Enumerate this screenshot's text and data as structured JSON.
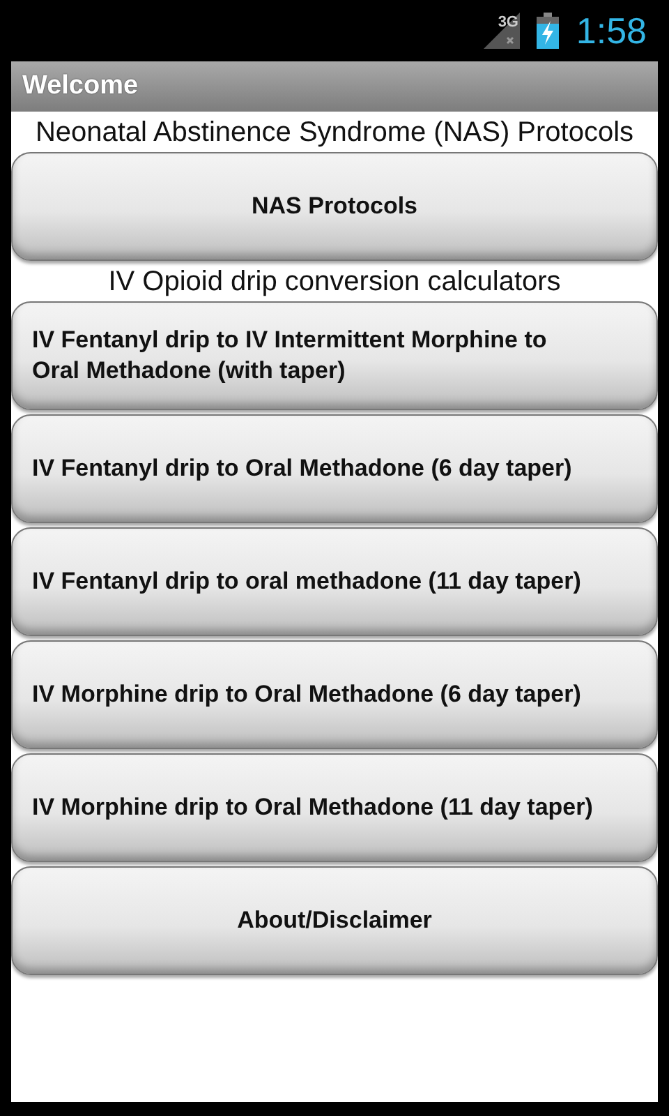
{
  "status_bar": {
    "network": "3G",
    "time": "1:58"
  },
  "title_bar": {
    "title": "Welcome"
  },
  "items": [
    {
      "kind": "heading",
      "text": "Neonatal Abstinence Syndrome (NAS) Protocols"
    },
    {
      "kind": "button",
      "text": "NAS Protocols",
      "centered": true
    },
    {
      "kind": "heading",
      "text": "IV Opioid drip conversion calculators"
    },
    {
      "kind": "button",
      "text": "IV Fentanyl drip to IV Intermittent Morphine to Oral Methadone (with taper)",
      "centered": false
    },
    {
      "kind": "button",
      "text": "IV Fentanyl drip to Oral Methadone (6 day taper)",
      "centered": false
    },
    {
      "kind": "button",
      "text": "IV Fentanyl drip to oral methadone (11 day taper)",
      "centered": false
    },
    {
      "kind": "button",
      "text": "IV Morphine drip to Oral Methadone (6 day taper)",
      "centered": false
    },
    {
      "kind": "button",
      "text": "IV Morphine drip to Oral Methadone (11 day taper)",
      "centered": false
    },
    {
      "kind": "button",
      "text": "About/Disclaimer",
      "centered": true
    }
  ]
}
